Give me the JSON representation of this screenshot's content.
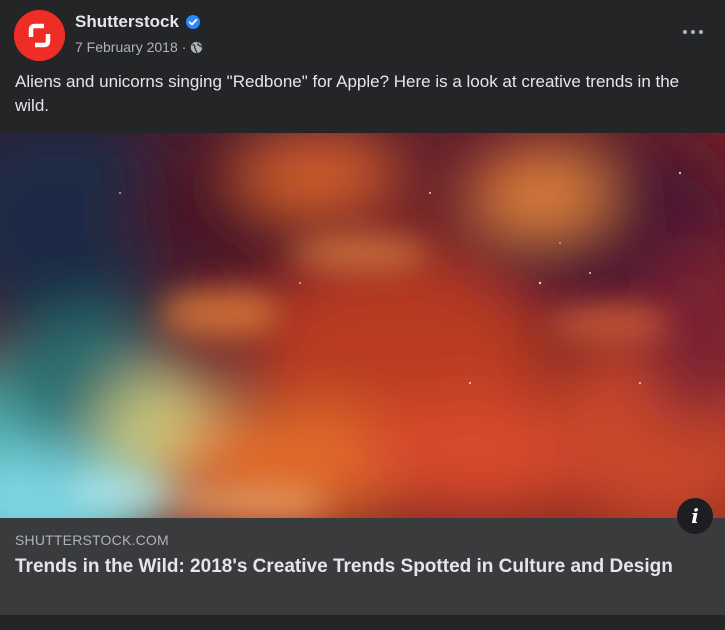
{
  "post": {
    "page_name": "Shutterstock",
    "date": "7 February 2018",
    "separator": "·",
    "text": "Aliens and unicorns singing \"Redbone\" for Apple? Here is a look at creative trends in the wild.",
    "icons": {
      "avatar": "shutterstock-logo",
      "verified": "verified-badge-icon",
      "privacy": "globe-icon",
      "more": "more-options-icon",
      "info": "info-icon"
    }
  },
  "link": {
    "image_description": "nebula-space-image",
    "domain": "SHUTTERSTOCK.COM",
    "title": "Trends in the Wild: 2018's Creative Trends Spotted in Culture and Design"
  },
  "colors": {
    "background": "#242526",
    "preview_bg": "#3a3b3c",
    "text_primary": "#e4e6eb",
    "text_secondary": "#b0b3b8",
    "verified_blue": "#2d88ff",
    "brand_red": "#ee2e24"
  }
}
